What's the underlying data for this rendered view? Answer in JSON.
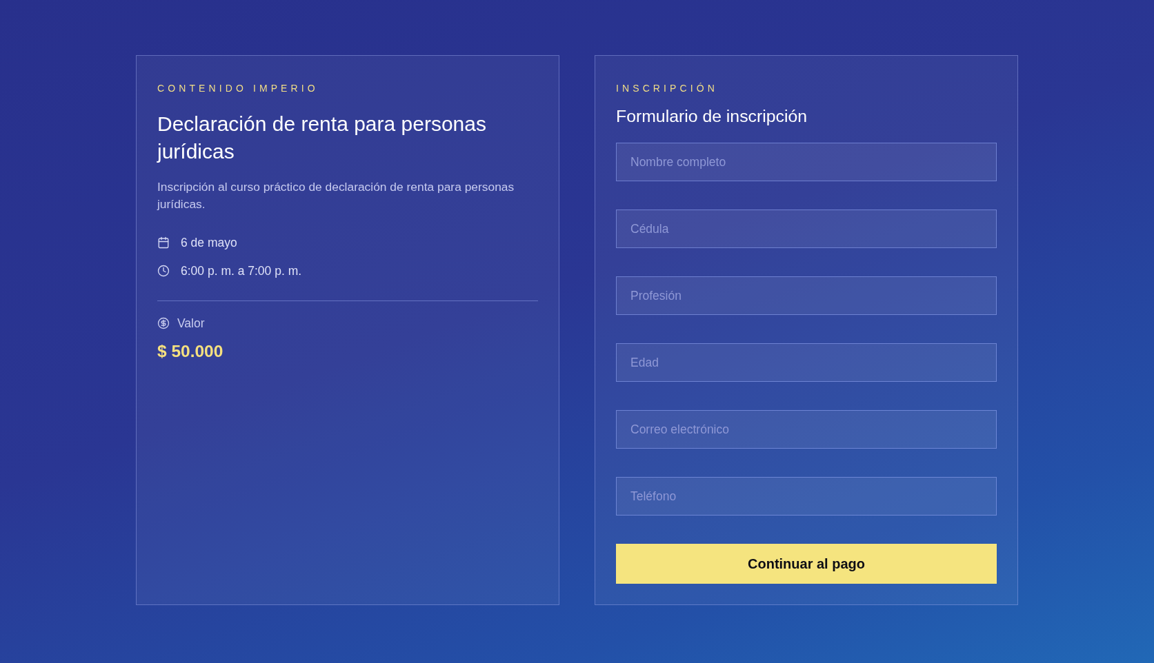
{
  "event": {
    "eyebrow": "CONTENIDO IMPERIO",
    "title": "Declaración de renta para personas jurídicas",
    "description": "Inscripción al curso práctico de declaración de renta para personas jurídicas.",
    "details": [
      {
        "kind": "date",
        "text": "6 de mayo"
      },
      {
        "kind": "time",
        "text": "6:00 p. m. a 7:00 p. m."
      }
    ],
    "price": {
      "label": "Valor",
      "amount": "$ 50.000"
    }
  },
  "form": {
    "eyebrow": "INSCRIPCIÓN",
    "title": "Formulario de inscripción",
    "fields": [
      {
        "placeholder": "Nombre completo"
      },
      {
        "placeholder": "Cédula"
      },
      {
        "placeholder": "Profesión"
      },
      {
        "placeholder": "Edad"
      },
      {
        "placeholder": "Correo electrónico"
      },
      {
        "placeholder": "Teléfono"
      }
    ],
    "submit": "Continuar al pago"
  }
}
